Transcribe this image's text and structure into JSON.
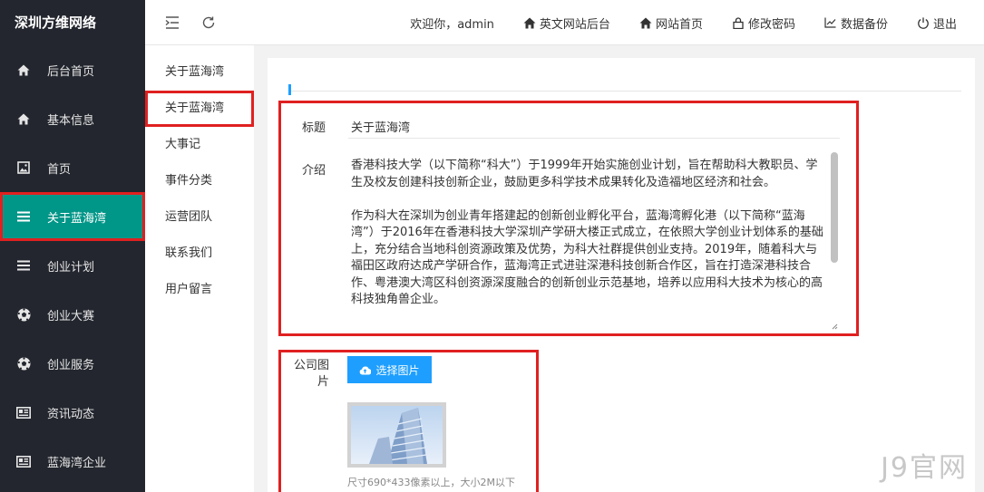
{
  "brand": "深圳方维网络",
  "sidebar": {
    "items": [
      {
        "label": "后台首页",
        "icon": "home-icon"
      },
      {
        "label": "基本信息",
        "icon": "home-icon"
      },
      {
        "label": "首页",
        "icon": "image-icon"
      },
      {
        "label": "关于蓝海湾",
        "icon": "list-icon"
      },
      {
        "label": "创业计划",
        "icon": "list-icon"
      },
      {
        "label": "创业大赛",
        "icon": "soccer-ball-icon"
      },
      {
        "label": "创业服务",
        "icon": "soccer-ball-icon"
      },
      {
        "label": "资讯动态",
        "icon": "newspaper-icon"
      },
      {
        "label": "蓝海湾企业",
        "icon": "newspaper-icon"
      }
    ],
    "active_index": 3
  },
  "header": {
    "welcome": "欢迎你，admin",
    "links": [
      {
        "label": "英文网站后台",
        "icon": "home-icon"
      },
      {
        "label": "网站首页",
        "icon": "home-icon"
      },
      {
        "label": "修改密码",
        "icon": "lock-icon"
      },
      {
        "label": "数据备份",
        "icon": "chart-icon"
      },
      {
        "label": "退出",
        "icon": "power-icon"
      }
    ]
  },
  "subnav": {
    "items": [
      "关于蓝海湾",
      "关于蓝海湾",
      "大事记",
      "事件分类",
      "运营团队",
      "联系我们",
      "用户留言"
    ],
    "active_index": 1
  },
  "form": {
    "title_label": "标题",
    "title_value": "关于蓝海湾",
    "intro_label": "介绍",
    "intro_paragraphs": [
      "香港科技大学（以下简称“科大”）于1999年开始实施创业计划，旨在帮助科大教职员、学生及校友创建科技创新企业，鼓励更多科学技术成果转化及造福地区经济和社会。",
      "作为科大在深圳为创业青年搭建起的创新创业孵化平台，蓝海湾孵化港（以下简称“蓝海湾”）于2016年在香港科技大学深圳产学研大楼正式成立，在依照大学创业计划体系的基础上，充分结合当地科创资源政策及优势，为科大社群提供创业支持。2019年，随着科大与福田区政府达成产学研合作，蓝海湾正式进驻深港科技创新合作区，旨在打造深港科技合作、粤港澳大湾区科创资源深度融合的创新创业示范基地，培养以应用科大技术为核心的高科技独角兽企业。"
    ],
    "image_label": "公司图片",
    "upload_button": "选择图片",
    "image_hint": "尺寸690*433像素以上，大小2M以下"
  },
  "watermark": "J9官网",
  "colors": {
    "sidebar_bg": "#23262e",
    "active_bg": "#009688",
    "accent_blue": "#1e9fff",
    "highlight_red": "#e02020"
  }
}
